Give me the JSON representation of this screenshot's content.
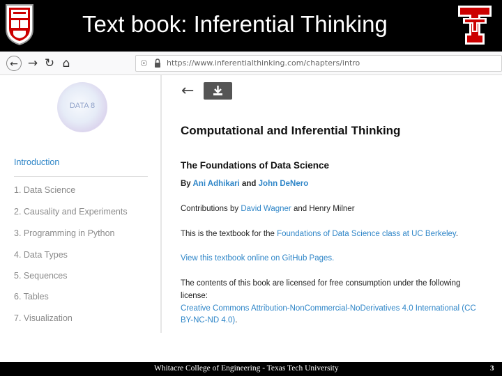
{
  "slide": {
    "title": "Text book: Inferential Thinking",
    "footer": "Whitacre College of Engineering - Texas Tech University",
    "page_number": "3"
  },
  "browser": {
    "url": "https://www.inferentialthinking.com/chapters/intro",
    "icons": [
      "back-arrow-icon",
      "forward-arrow-icon",
      "reload-icon",
      "home-icon",
      "shield-icon",
      "lock-icon"
    ]
  },
  "sidebar": {
    "logo_text": "DATA 8",
    "items": [
      {
        "label": "Introduction",
        "active": true
      },
      {
        "label": "1. Data Science"
      },
      {
        "label": "2. Causality and Experiments"
      },
      {
        "label": "3. Programming in Python"
      },
      {
        "label": "4. Data Types"
      },
      {
        "label": "5. Sequences"
      },
      {
        "label": "6. Tables"
      },
      {
        "label": "7. Visualization"
      }
    ]
  },
  "content": {
    "title": "Computational and Inferential Thinking",
    "subtitle": "The Foundations of Data Science",
    "by": "By",
    "author1": "Ani Adhikari",
    "and": "and",
    "author2": "John DeNero",
    "contrib_prefix": "Contributions by",
    "contrib_link": "David Wagner",
    "contrib_suffix": "and Henry Milner",
    "textbook_prefix": "This is the textbook for the",
    "textbook_link": "Foundations of Data Science class at UC Berkeley",
    "textbook_suffix": ".",
    "github_link": "View this textbook online on GitHub Pages.",
    "license_line1": "The contents of this book are licensed for free consumption under the following",
    "license_line2": "license:",
    "license_link1": "Creative Commons Attribution-NonCommercial-NoDerivatives 4.0 International (CC",
    "license_link2": "BY-NC-ND 4.0)",
    "license_end": "."
  },
  "colors": {
    "header_bg": "#000000",
    "link": "#2f86c8",
    "ttu_red": "#cc0000"
  }
}
